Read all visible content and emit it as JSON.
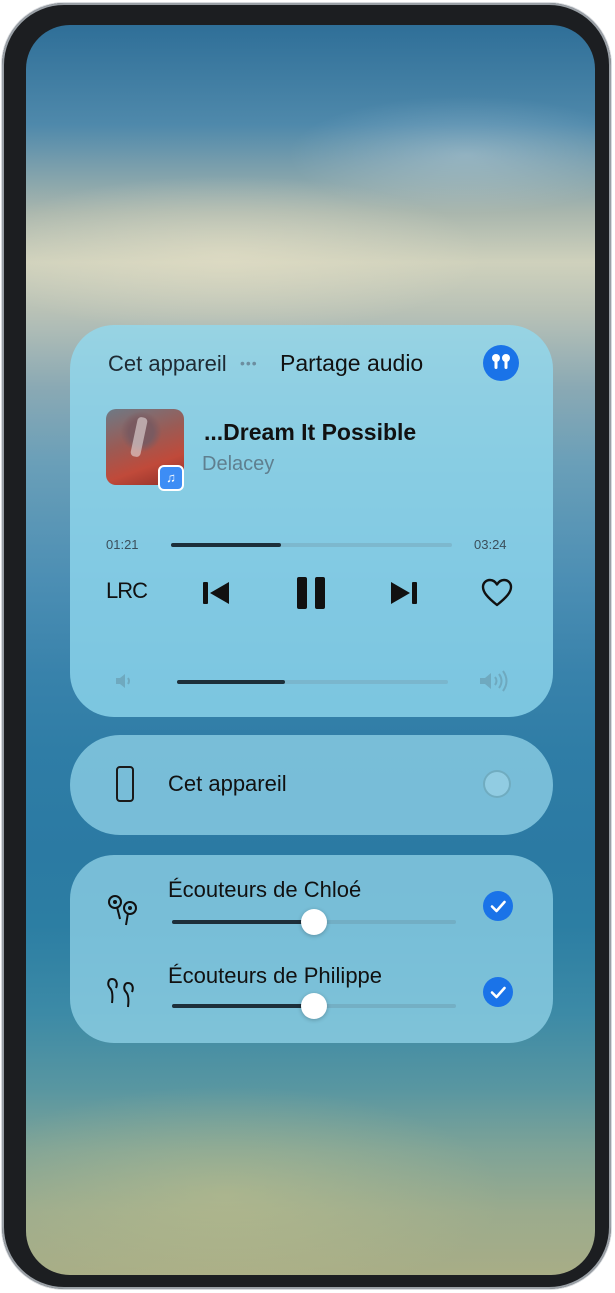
{
  "audio_panel": {
    "source_label": "Cet appareil",
    "share_label": "Partage audio",
    "share_icon": "earbuds-icon",
    "song_title": "...Dream It Possible",
    "artist": "Delacey",
    "elapsed": "01:21",
    "duration": "03:24",
    "progress_fraction": 0.39,
    "lyrics_label": "LRC",
    "volume_fraction": 0.4
  },
  "output_device": {
    "label": "Cet appareil",
    "icon": "phone-icon",
    "selected": false
  },
  "headphones": [
    {
      "label": "Écouteurs de Chloé",
      "icon": "earbuds-icon",
      "volume_fraction": 0.5,
      "selected": true
    },
    {
      "label": "Écouteurs de Philippe",
      "icon": "earbuds-icon",
      "volume_fraction": 0.5,
      "selected": true
    }
  ],
  "colors": {
    "accent": "#1a73e8",
    "panel": "#91daf0"
  }
}
